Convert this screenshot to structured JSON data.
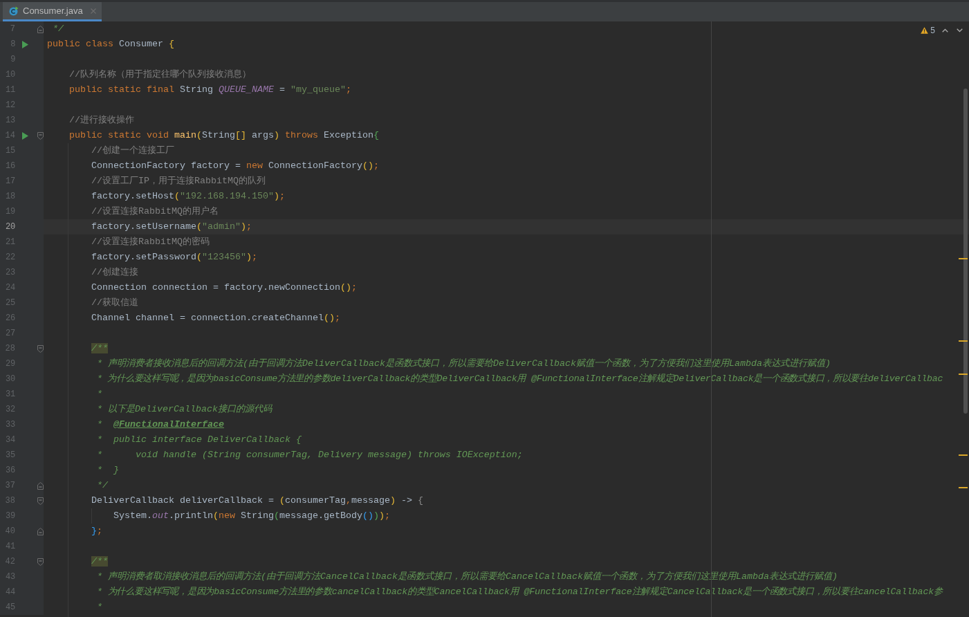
{
  "tabs": [
    {
      "label": "Consumer.java",
      "selected": true
    }
  ],
  "inspections": {
    "warning_count": "5"
  },
  "lines": [
    {
      "number": "7",
      "selected": false,
      "run": false,
      "fold_start": false,
      "fold_end": true,
      "tokens": [
        {
          "text": " */",
          "kind": "doc"
        }
      ]
    },
    {
      "number": "8",
      "selected": false,
      "run": true,
      "fold_start": false,
      "fold_end": false,
      "tokens": [
        {
          "text": "public class",
          "kind": "keyword"
        },
        {
          "text": " Consumer ",
          "kind": "plain"
        },
        {
          "text": "{",
          "kind": "bracket1"
        }
      ]
    },
    {
      "number": "9",
      "selected": false,
      "run": false,
      "fold_start": false,
      "fold_end": false
    },
    {
      "number": "10",
      "selected": false,
      "run": false,
      "fold_start": false,
      "fold_end": false,
      "tokens": [
        {
          "text": "    //队列名称（用于指定往哪个队列接收消息）",
          "kind": "comment"
        }
      ]
    },
    {
      "number": "11",
      "selected": false,
      "run": false,
      "fold_start": false,
      "fold_end": false,
      "tokens": [
        {
          "text": "    public static final",
          "kind": "keyword"
        },
        {
          "text": " String ",
          "kind": "plain"
        },
        {
          "text": "QUEUE_NAME",
          "kind": "field"
        },
        {
          "text": " = ",
          "kind": "plain"
        },
        {
          "text": "\"my_queue\"",
          "kind": "string"
        },
        {
          "text": ";",
          "kind": "punct"
        }
      ]
    },
    {
      "number": "12",
      "selected": false,
      "run": false,
      "fold_start": false,
      "fold_end": false
    },
    {
      "number": "13",
      "selected": false,
      "run": false,
      "fold_start": false,
      "fold_end": false,
      "tokens": [
        {
          "text": "    //进行接收操作",
          "kind": "comment"
        }
      ]
    },
    {
      "number": "14",
      "selected": false,
      "run": true,
      "fold_start": true,
      "fold_end": false,
      "tokens": [
        {
          "text": "    public static void ",
          "kind": "keyword"
        },
        {
          "text": "main",
          "kind": "method"
        },
        {
          "text": "(",
          "kind": "bracket1"
        },
        {
          "text": "String",
          "kind": "plain"
        },
        {
          "text": "[]",
          "kind": "bracket1"
        },
        {
          "text": " args",
          "kind": "plain"
        },
        {
          "text": ")",
          "kind": "bracket1"
        },
        {
          "text": " throws",
          "kind": "keyword"
        },
        {
          "text": " Exception",
          "kind": "plain"
        },
        {
          "text": "{",
          "kind": "bracket2"
        }
      ]
    },
    {
      "number": "15",
      "selected": false,
      "run": false,
      "fold_start": false,
      "fold_end": false,
      "tokens": [
        {
          "text": "        //创建一个连接工厂",
          "kind": "comment"
        }
      ]
    },
    {
      "number": "16",
      "selected": false,
      "run": false,
      "fold_start": false,
      "fold_end": false,
      "tokens": [
        {
          "text": "        ConnectionFactory factory = ",
          "kind": "plain"
        },
        {
          "text": "new",
          "kind": "keyword"
        },
        {
          "text": " ConnectionFactory",
          "kind": "plain"
        },
        {
          "text": "()",
          "kind": "bracket1"
        },
        {
          "text": ";",
          "kind": "punct"
        }
      ]
    },
    {
      "number": "17",
      "selected": false,
      "run": false,
      "fold_start": false,
      "fold_end": false,
      "tokens": [
        {
          "text": "        //设置工厂IP，用于连接RabbitMQ的队列",
          "kind": "comment"
        }
      ]
    },
    {
      "number": "18",
      "selected": false,
      "run": false,
      "fold_start": false,
      "fold_end": false,
      "tokens": [
        {
          "text": "        factory.setHost",
          "kind": "plain"
        },
        {
          "text": "(",
          "kind": "bracket1"
        },
        {
          "text": "\"192.168.194.150\"",
          "kind": "string"
        },
        {
          "text": ")",
          "kind": "bracket1"
        },
        {
          "text": ";",
          "kind": "punct"
        }
      ]
    },
    {
      "number": "19",
      "selected": false,
      "run": false,
      "fold_start": false,
      "fold_end": false,
      "tokens": [
        {
          "text": "        //设置连接RabbitMQ的用户名",
          "kind": "comment"
        }
      ]
    },
    {
      "number": "20",
      "selected": true,
      "run": false,
      "fold_start": false,
      "fold_end": false,
      "tokens": [
        {
          "text": "        factory.setUsername",
          "kind": "plain"
        },
        {
          "text": "(",
          "kind": "bracket1"
        },
        {
          "text": "\"admin\"",
          "kind": "string"
        },
        {
          "text": ")",
          "kind": "bracket1"
        },
        {
          "text": ";",
          "kind": "punct"
        }
      ]
    },
    {
      "number": "21",
      "selected": false,
      "run": false,
      "fold_start": false,
      "fold_end": false,
      "tokens": [
        {
          "text": "        //设置连接RabbitMQ的密码",
          "kind": "comment"
        }
      ]
    },
    {
      "number": "22",
      "selected": false,
      "run": false,
      "fold_start": false,
      "fold_end": false,
      "tokens": [
        {
          "text": "        factory.setPassword",
          "kind": "plain"
        },
        {
          "text": "(",
          "kind": "bracket1"
        },
        {
          "text": "\"123456\"",
          "kind": "string"
        },
        {
          "text": ")",
          "kind": "bracket1"
        },
        {
          "text": ";",
          "kind": "punct"
        }
      ]
    },
    {
      "number": "23",
      "selected": false,
      "run": false,
      "fold_start": false,
      "fold_end": false,
      "tokens": [
        {
          "text": "        //创建连接",
          "kind": "comment"
        }
      ]
    },
    {
      "number": "24",
      "selected": false,
      "run": false,
      "fold_start": false,
      "fold_end": false,
      "tokens": [
        {
          "text": "        Connection connection = factory.newConnection",
          "kind": "plain"
        },
        {
          "text": "()",
          "kind": "bracket1"
        },
        {
          "text": ";",
          "kind": "punct"
        }
      ]
    },
    {
      "number": "25",
      "selected": false,
      "run": false,
      "fold_start": false,
      "fold_end": false,
      "tokens": [
        {
          "text": "        //获取信道",
          "kind": "comment"
        }
      ]
    },
    {
      "number": "26",
      "selected": false,
      "run": false,
      "fold_start": false,
      "fold_end": false,
      "tokens": [
        {
          "text": "        Channel channel = connection.createChannel",
          "kind": "plain"
        },
        {
          "text": "()",
          "kind": "bracket1"
        },
        {
          "text": ";",
          "kind": "punct"
        }
      ]
    },
    {
      "number": "27",
      "selected": false,
      "run": false,
      "fold_start": false,
      "fold_end": false
    },
    {
      "number": "28",
      "selected": false,
      "run": false,
      "fold_start": true,
      "fold_end": false,
      "tokens": [
        {
          "text": "        /**",
          "kind": "doc_open"
        }
      ]
    },
    {
      "number": "29",
      "selected": false,
      "run": false,
      "fold_start": false,
      "fold_end": false,
      "tokens": [
        {
          "text": "         * 声明消费者接收消息后的回调方法(由于回调方法DeliverCallback是函数式接口，所以需要给DeliverCallback赋值一个函数，为了方便我们这里使用Lambda表达式进行赋值)",
          "kind": "doc"
        }
      ]
    },
    {
      "number": "30",
      "selected": false,
      "run": false,
      "fold_start": false,
      "fold_end": false,
      "tokens": [
        {
          "text": "         * 为什么要这样写呢，是因为basicConsume方法里的参数deliverCallback的类型DeliverCallback用 @FunctionalInterface注解规定DeliverCallback是一个函数式接口，所以要往deliverCallbac",
          "kind": "doc"
        }
      ]
    },
    {
      "number": "31",
      "selected": false,
      "run": false,
      "fold_start": false,
      "fold_end": false,
      "tokens": [
        {
          "text": "         *",
          "kind": "doc"
        }
      ]
    },
    {
      "number": "32",
      "selected": false,
      "run": false,
      "fold_start": false,
      "fold_end": false,
      "tokens": [
        {
          "text": "         * 以下是DeliverCallback接口的源代码",
          "kind": "doc"
        }
      ]
    },
    {
      "number": "33",
      "selected": false,
      "run": false,
      "fold_start": false,
      "fold_end": false,
      "tokens": [
        {
          "text": "         *  ",
          "kind": "doc"
        },
        {
          "text": "@FunctionalInterface",
          "kind": "doc_tag"
        }
      ]
    },
    {
      "number": "34",
      "selected": false,
      "run": false,
      "fold_start": false,
      "fold_end": false,
      "tokens": [
        {
          "text": "         *  public interface DeliverCallback {",
          "kind": "doc"
        }
      ]
    },
    {
      "number": "35",
      "selected": false,
      "run": false,
      "fold_start": false,
      "fold_end": false,
      "tokens": [
        {
          "text": "         *      void handle (String consumerTag, Delivery message) throws IOException;",
          "kind": "doc"
        }
      ]
    },
    {
      "number": "36",
      "selected": false,
      "run": false,
      "fold_start": false,
      "fold_end": false,
      "tokens": [
        {
          "text": "         *  }",
          "kind": "doc"
        }
      ]
    },
    {
      "number": "37",
      "selected": false,
      "run": false,
      "fold_start": false,
      "fold_end": true,
      "tokens": [
        {
          "text": "         */",
          "kind": "doc"
        }
      ]
    },
    {
      "number": "38",
      "selected": false,
      "run": false,
      "fold_start": true,
      "fold_end": false,
      "tokens": [
        {
          "text": "        DeliverCallback deliverCallback = ",
          "kind": "plain"
        },
        {
          "text": "(",
          "kind": "bracket1"
        },
        {
          "text": "consumerTag",
          "kind": "plain"
        },
        {
          "text": ",",
          "kind": "punct"
        },
        {
          "text": "message",
          "kind": "plain"
        },
        {
          "text": ")",
          "kind": "bracket1"
        },
        {
          "text": " -> ",
          "kind": "plain"
        },
        {
          "text": "{",
          "kind": "muted"
        }
      ]
    },
    {
      "number": "39",
      "selected": false,
      "run": false,
      "fold_start": false,
      "fold_end": false,
      "tokens": [
        {
          "text": "            System.",
          "kind": "plain"
        },
        {
          "text": "out",
          "kind": "field"
        },
        {
          "text": ".println",
          "kind": "plain"
        },
        {
          "text": "(",
          "kind": "bracket1"
        },
        {
          "text": "new",
          "kind": "keyword"
        },
        {
          "text": " String",
          "kind": "plain"
        },
        {
          "text": "(",
          "kind": "bracket2"
        },
        {
          "text": "message.getBody",
          "kind": "plain"
        },
        {
          "text": "()",
          "kind": "bracket3"
        },
        {
          "text": ")",
          "kind": "bracket2"
        },
        {
          "text": ")",
          "kind": "bracket1"
        },
        {
          "text": ";",
          "kind": "punct"
        }
      ]
    },
    {
      "number": "40",
      "selected": false,
      "run": false,
      "fold_start": false,
      "fold_end": true,
      "tokens": [
        {
          "text": "        }",
          "kind": "bracket3"
        },
        {
          "text": ";",
          "kind": "punct"
        }
      ]
    },
    {
      "number": "41",
      "selected": false,
      "run": false,
      "fold_start": false,
      "fold_end": false
    },
    {
      "number": "42",
      "selected": false,
      "run": false,
      "fold_start": true,
      "fold_end": false,
      "tokens": [
        {
          "text": "        /**",
          "kind": "doc_open"
        }
      ]
    },
    {
      "number": "43",
      "selected": false,
      "run": false,
      "fold_start": false,
      "fold_end": false,
      "tokens": [
        {
          "text": "         * 声明消费者取消接收消息后的回调方法(由于回调方法CancelCallback是函数式接口，所以需要给CancelCallback赋值一个函数，为了方便我们这里使用Lambda表达式进行赋值)",
          "kind": "doc"
        }
      ]
    },
    {
      "number": "44",
      "selected": false,
      "run": false,
      "fold_start": false,
      "fold_end": false,
      "tokens": [
        {
          "text": "         * 为什么要这样写呢，是因为basicConsume方法里的参数cancelCallback的类型CancelCallback用 @FunctionalInterface注解规定CancelCallback是一个函数式接口，所以要往cancelCallback参",
          "kind": "doc"
        }
      ]
    },
    {
      "number": "45",
      "selected": false,
      "run": false,
      "fold_start": false,
      "fold_end": false,
      "tokens": [
        {
          "text": "         *",
          "kind": "doc"
        }
      ]
    }
  ]
}
